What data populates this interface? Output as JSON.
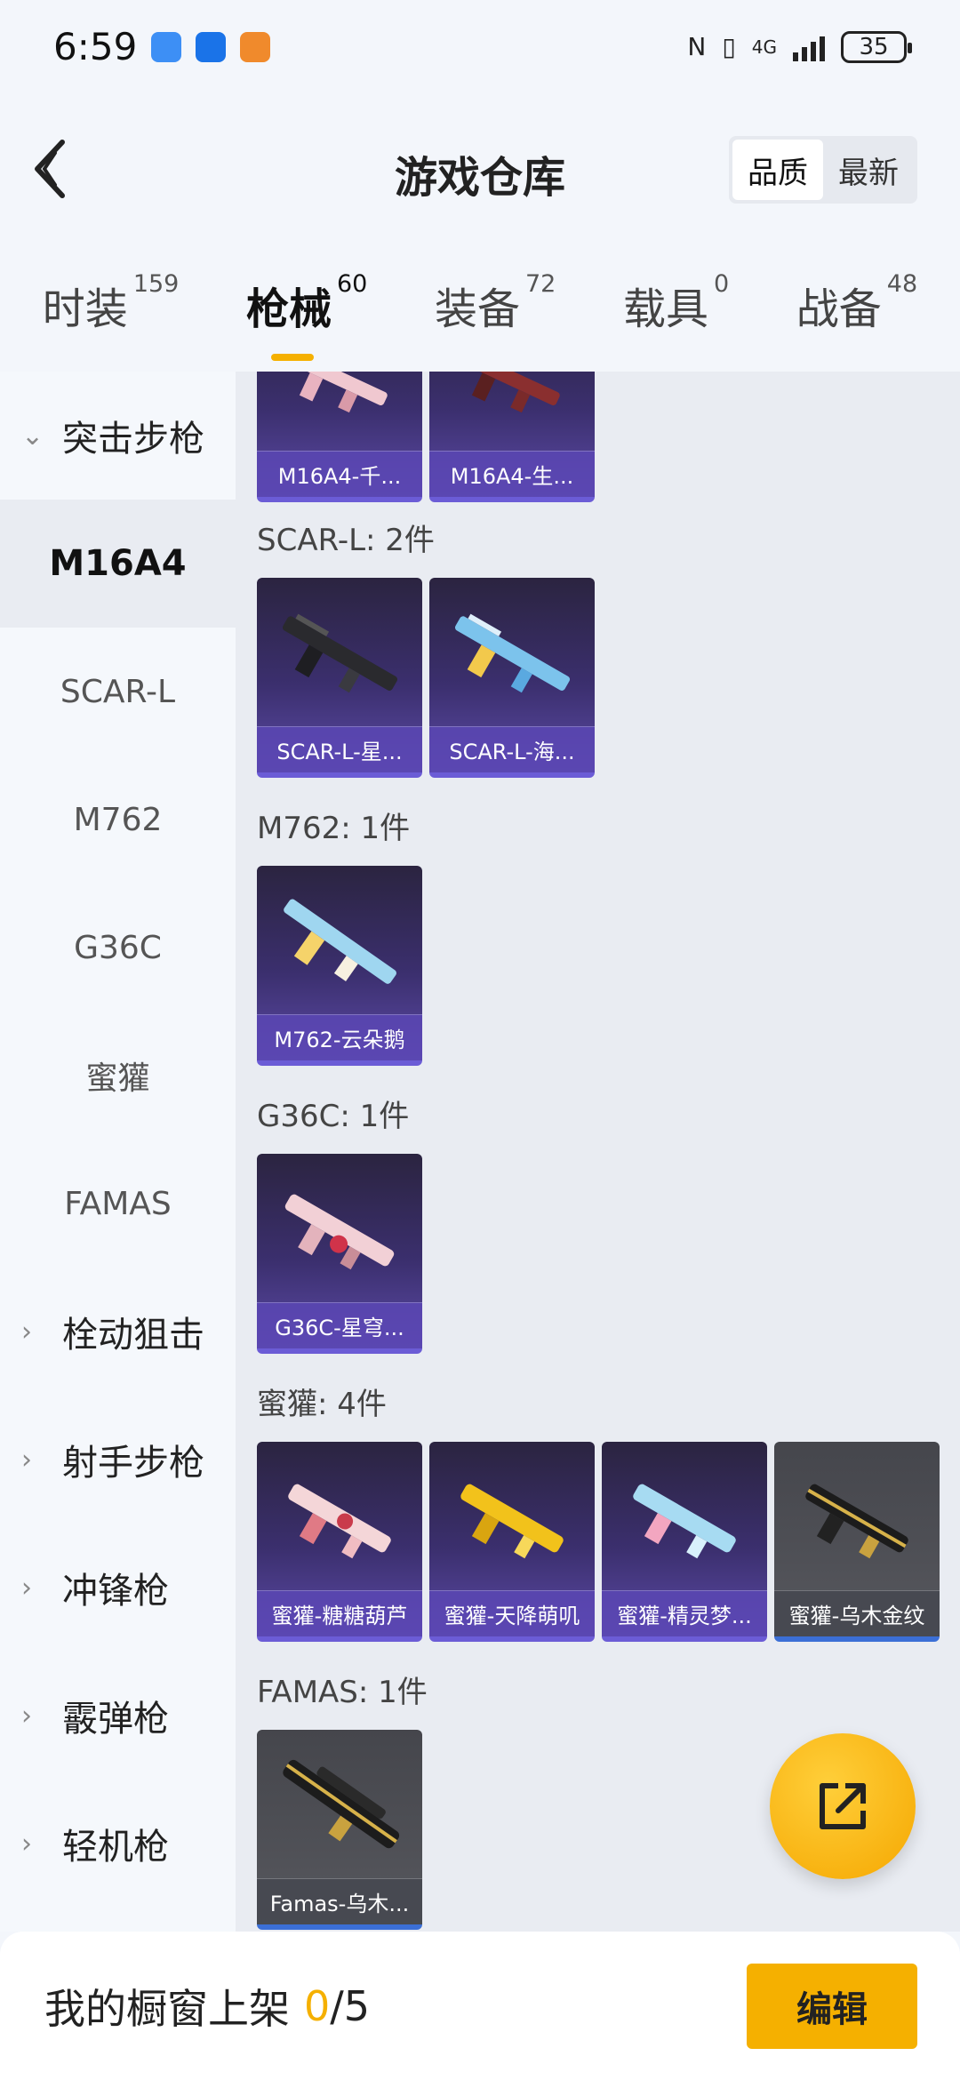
{
  "status_bar": {
    "time": "6:59",
    "network": "4G",
    "battery": "35",
    "icons": [
      "app-icon-1",
      "app-icon-2",
      "app-icon-3",
      "nfc-icon",
      "vibrate-icon",
      "signal-icon",
      "battery-icon"
    ]
  },
  "header": {
    "title": "游戏仓库",
    "sort": {
      "options": [
        "品质",
        "最新"
      ],
      "selected": "品质"
    }
  },
  "category_tabs": [
    {
      "label": "时装",
      "count": "159",
      "active": false
    },
    {
      "label": "枪械",
      "count": "60",
      "active": true
    },
    {
      "label": "装备",
      "count": "72",
      "active": false
    },
    {
      "label": "载具",
      "count": "0",
      "active": false
    },
    {
      "label": "战备",
      "count": "48",
      "active": false
    }
  ],
  "left_nav": [
    {
      "label": "突击步枪",
      "type": "group",
      "expanded": true
    },
    {
      "label": "M16A4",
      "type": "item",
      "selected": true
    },
    {
      "label": "SCAR-L",
      "type": "item"
    },
    {
      "label": "M762",
      "type": "item"
    },
    {
      "label": "G36C",
      "type": "item"
    },
    {
      "label": "蜜獾",
      "type": "item"
    },
    {
      "label": "FAMAS",
      "type": "item"
    },
    {
      "label": "栓动狙击",
      "type": "group"
    },
    {
      "label": "射手步枪",
      "type": "group"
    },
    {
      "label": "冲锋枪",
      "type": "group"
    },
    {
      "label": "霰弹枪",
      "type": "group"
    },
    {
      "label": "轻机枪",
      "type": "group"
    }
  ],
  "sections": [
    {
      "label": "",
      "items": [
        {
          "name": "M16A4-千...",
          "color": "pink"
        },
        {
          "name": "M16A4-生...",
          "color": "red"
        }
      ]
    },
    {
      "label": "SCAR-L: 2件",
      "items": [
        {
          "name": "SCAR-L-星...",
          "color": "black"
        },
        {
          "name": "SCAR-L-海...",
          "color": "blue"
        }
      ]
    },
    {
      "label": "M762: 1件",
      "items": [
        {
          "name": "M762-云朵鹅",
          "color": "blue"
        }
      ]
    },
    {
      "label": "G36C: 1件",
      "items": [
        {
          "name": "G36C-星穹...",
          "color": "pink"
        }
      ]
    },
    {
      "label": "蜜獾: 4件",
      "items": [
        {
          "name": "蜜獾-糖糖葫芦",
          "color": "pink"
        },
        {
          "name": "蜜獾-天降萌叽",
          "color": "gold"
        },
        {
          "name": "蜜獾-精灵梦...",
          "color": "blue"
        },
        {
          "name": "蜜獾-乌木金纹",
          "color": "goldblack",
          "gray": true
        }
      ]
    },
    {
      "label": "FAMAS: 1件",
      "items": [
        {
          "name": "Famas-乌木...",
          "color": "goldblack",
          "gray": true
        }
      ]
    }
  ],
  "bottom_bar": {
    "label": "我的橱窗上架",
    "shown": "0",
    "total": "/5",
    "edit_label": "编辑"
  },
  "colors": {
    "accent": "#f5b000",
    "card_purple": "#3b2f6e",
    "card_gray": "#4f5056"
  }
}
